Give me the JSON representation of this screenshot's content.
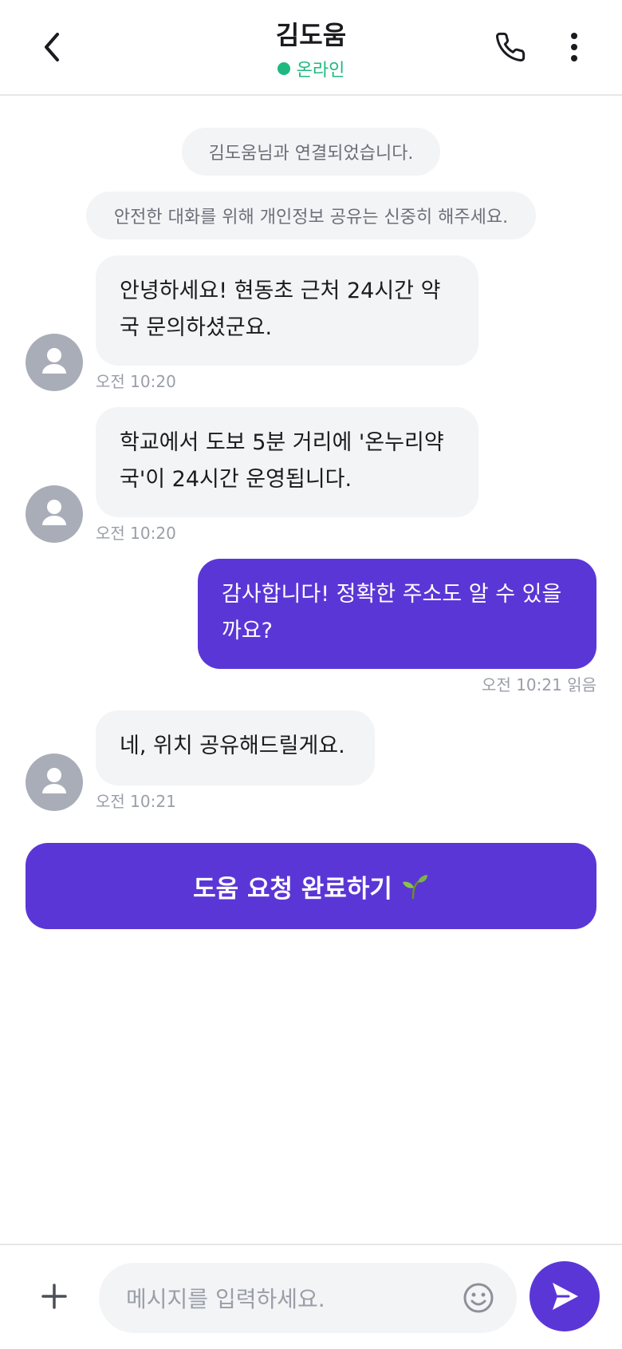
{
  "header": {
    "title": "김도움",
    "status": "온라인",
    "back_icon": "chevron-left-icon",
    "call_icon": "phone-icon",
    "more_icon": "more-vertical-icon"
  },
  "system_messages": [
    "김도움님과 연결되었습니다.",
    "안전한 대화를 위해 개인정보 공유는 신중히 해주세요."
  ],
  "messages": [
    {
      "from": "other",
      "text": "안녕하세요! 현동초 근처 24시간 약국 문의하셨군요.",
      "time": "오전 10:20"
    },
    {
      "from": "other",
      "text": "학교에서 도보 5분 거리에 '온누리약국'이 24시간 운영됩니다.",
      "time": "오전 10:20"
    },
    {
      "from": "me",
      "text": "감사합니다! 정확한 주소도 알 수 있을까요?",
      "time": "오전 10:21 읽음"
    },
    {
      "from": "other",
      "text": "네, 위치 공유해드릴게요.",
      "time": "오전 10:21"
    }
  ],
  "complete_button": {
    "label": "도움 요청 완료하기",
    "icon": "sprout-icon"
  },
  "composer": {
    "placeholder": "메시지를 입력하세요.",
    "value": "",
    "plus_icon": "plus-icon",
    "emoji_icon": "smiley-icon",
    "send_icon": "send-icon"
  },
  "colors": {
    "accent": "#5b36d6",
    "online": "#1eb980",
    "bubble_in": "#f3f4f6",
    "avatar": "#a9adb8",
    "muted_text": "#9a9ea8"
  }
}
